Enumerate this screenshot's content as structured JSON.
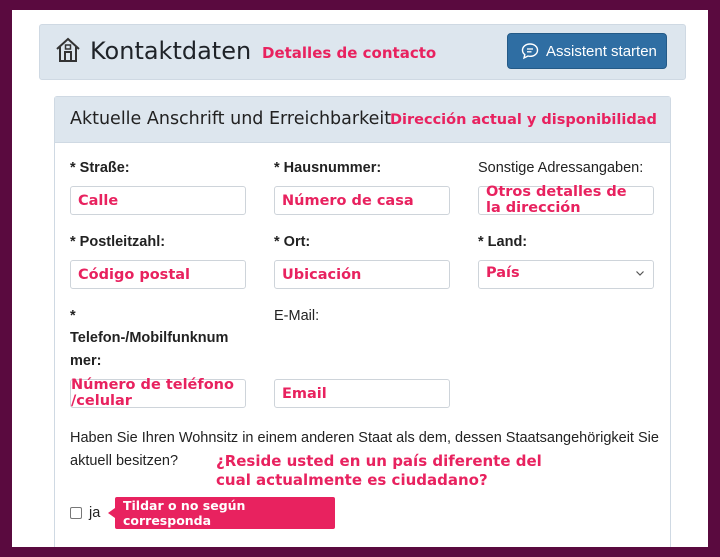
{
  "header": {
    "title": "Kontaktdaten",
    "title_annotation": "Detalles de contacto",
    "assistant_button": "Assistent starten",
    "home_icon": "home-icon",
    "chat_icon": "chat-bubble-icon"
  },
  "section": {
    "title": "Aktuelle Anschrift und Erreichbarkeit",
    "title_annotation": "Dirección actual y disponibilidad"
  },
  "fields": {
    "street": {
      "label": "* Straße:",
      "annotation": "Calle"
    },
    "house_number": {
      "label": "* Hausnummer:",
      "annotation": "Número de casa"
    },
    "other_address": {
      "label": "Sonstige Adressangaben:",
      "annotation": "Otros detalles de la dirección"
    },
    "postal_code": {
      "label": "* Postleitzahl:",
      "annotation": "Código postal"
    },
    "city": {
      "label": "* Ort:",
      "annotation": "Ubicación"
    },
    "country": {
      "label": "* Land:",
      "annotation": "País"
    },
    "phone": {
      "label_star": "*",
      "label_line1": "Telefon-/Mobilfunknum",
      "label_line2": "mer:",
      "annotation": "Número de teléfono /celular"
    },
    "email": {
      "label": "E-Mail:",
      "annotation": "Email"
    }
  },
  "residence_question": {
    "text": "Haben Sie Ihren Wohnsitz in einem anderen Staat als dem, dessen Staatsangehörigkeit Sie aktuell besitzen?",
    "annotation": "¿Reside usted en un país diferente del cual actualmente es ciudadano?",
    "checkbox_label": "ja",
    "checkbox_checked": false,
    "tooltip": "Tildar o no según corresponda"
  },
  "colors": {
    "background": "#5a0a3f",
    "annotation": "#e8225f",
    "button": "#2f6ea3",
    "header_bg": "#dde6ee"
  }
}
